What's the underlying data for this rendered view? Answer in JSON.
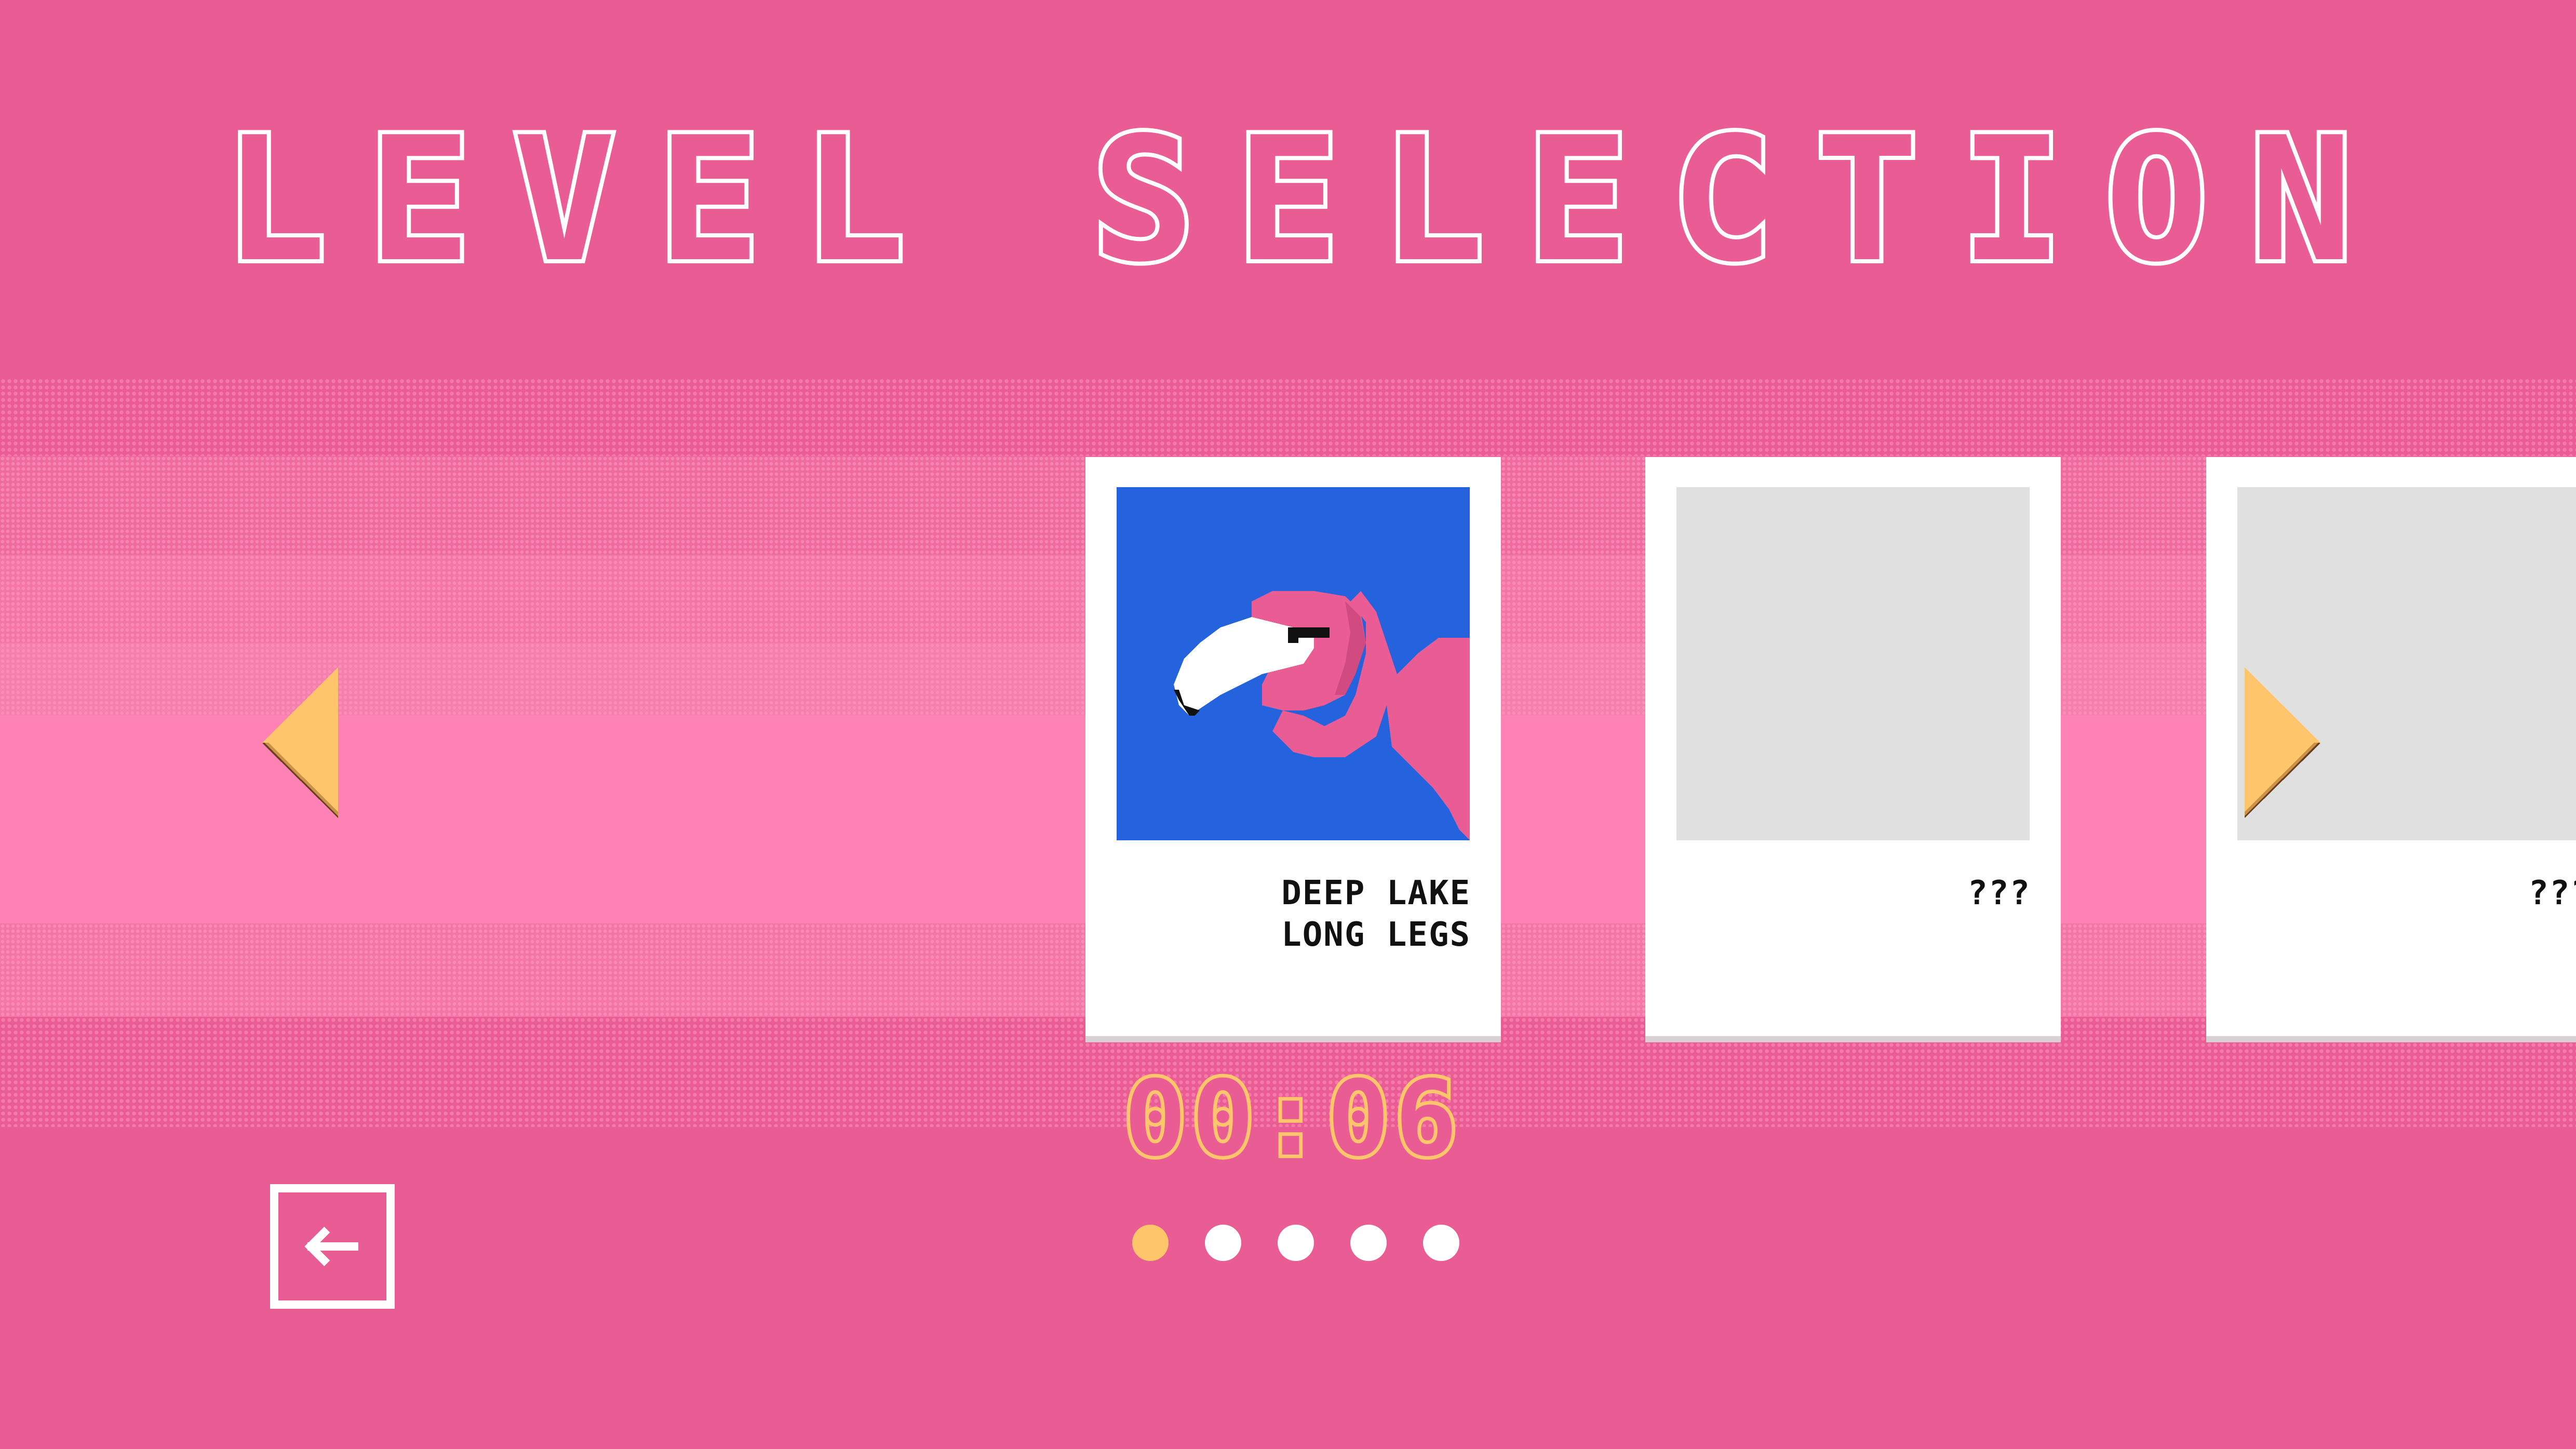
{
  "title": "LEVEL SELECTION",
  "levels": [
    {
      "name": "DEEP LAKE\nLONG LEGS",
      "thumbnail": "flamingo-icon",
      "locked": false
    },
    {
      "name": "???",
      "thumbnail": "locked-placeholder",
      "locked": true
    },
    {
      "name": "???",
      "thumbnail": "locked-placeholder",
      "locked": true
    }
  ],
  "timer": "00:06",
  "pagination": {
    "total": 5,
    "active_index": 0
  },
  "icons": {
    "prev": "arrow-left-icon",
    "next": "arrow-right-icon",
    "back": "back-arrow-icon"
  },
  "colors": {
    "background": "#ea5d94",
    "accent": "#ffc56b",
    "card": "#ffffff",
    "thumbnail_blue": "#2562de",
    "placeholder": "#e0e0e0",
    "flamingo": "#ea5d94"
  }
}
